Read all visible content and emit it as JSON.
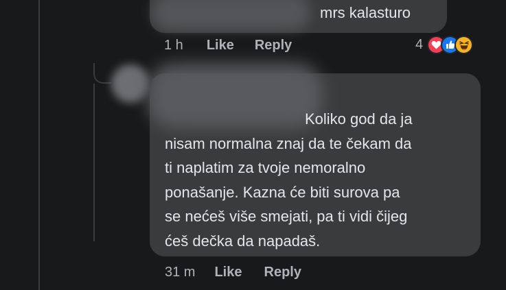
{
  "comment1": {
    "text": "mrs kalasturo",
    "time": "1 h",
    "like_label": "Like",
    "reply_label": "Reply",
    "reaction_count": "4",
    "reactions": [
      "heart-icon",
      "like-icon",
      "haha-icon"
    ]
  },
  "comment2": {
    "text_lines": [
      "Koliko god da ja",
      "nisam normalna znaj da te čekam da",
      "ti naplatim za tvoje nemoralno",
      "ponašanje. Kazna će biti surova pa",
      "se nećeš više smejati, pa ti vidi čijeg",
      "ćeš dečka da napadaš."
    ],
    "time": "31 m",
    "like_label": "Like",
    "reply_label": "Reply"
  },
  "colors": {
    "background": "#18191a",
    "bubble": "#3a3b3c",
    "text": "#e4e6eb",
    "meta": "#b0b3b8",
    "heart": "#f33e58",
    "like": "#1877f2",
    "haha": "#f7b125"
  }
}
